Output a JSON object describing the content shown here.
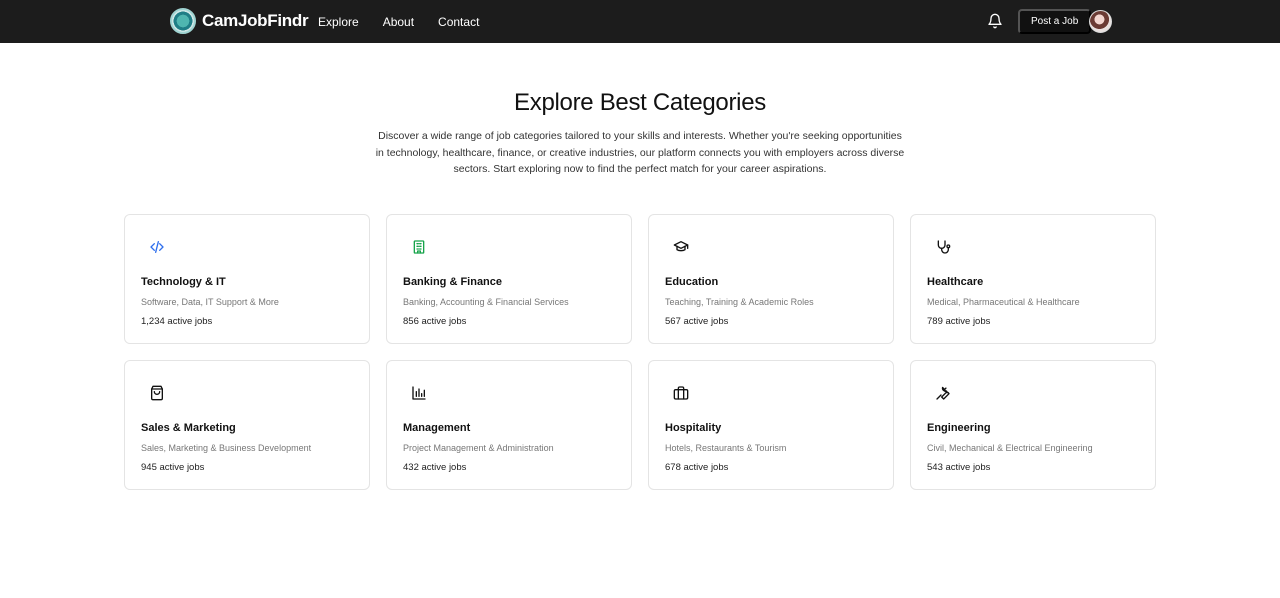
{
  "nav": {
    "brand": "CamJobFindr",
    "links": [
      "Explore",
      "About",
      "Contact"
    ],
    "post_job": "Post a Job",
    "bell_icon": "bell-icon",
    "avatar_icon": "user-avatar"
  },
  "hero": {
    "title": "Explore Best Categories",
    "description": "Discover a wide range of job categories tailored to your skills and interests. Whether you're seeking opportunities in technology, healthcare, finance, or creative industries, our platform connects you with employers across diverse sectors. Start exploring now to find the perfect match for your career aspirations."
  },
  "categories": [
    {
      "name": "Technology & IT",
      "sub": "Software, Data, IT Support & More",
      "count": "1,234 active jobs",
      "icon": "code-icon",
      "color": "#2f6fed"
    },
    {
      "name": "Banking & Finance",
      "sub": "Banking, Accounting & Financial Services",
      "count": "856 active jobs",
      "icon": "building-icon",
      "color": "#16a34a"
    },
    {
      "name": "Education",
      "sub": "Teaching, Training & Academic Roles",
      "count": "567 active jobs",
      "icon": "graduation-cap-icon",
      "color": "#111111"
    },
    {
      "name": "Healthcare",
      "sub": "Medical, Pharmaceutical & Healthcare",
      "count": "789 active jobs",
      "icon": "stethoscope-icon",
      "color": "#111111"
    },
    {
      "name": "Sales & Marketing",
      "sub": "Sales, Marketing & Business Development",
      "count": "945 active jobs",
      "icon": "shopping-bag-icon",
      "color": "#111111"
    },
    {
      "name": "Management",
      "sub": "Project Management & Administration",
      "count": "432 active jobs",
      "icon": "bar-chart-icon",
      "color": "#111111"
    },
    {
      "name": "Hospitality",
      "sub": "Hotels, Restaurants & Tourism",
      "count": "678 active jobs",
      "icon": "briefcase-icon",
      "color": "#111111"
    },
    {
      "name": "Engineering",
      "sub": "Civil, Mechanical & Electrical Engineering",
      "count": "543 active jobs",
      "icon": "wrench-icon",
      "color": "#111111"
    }
  ]
}
